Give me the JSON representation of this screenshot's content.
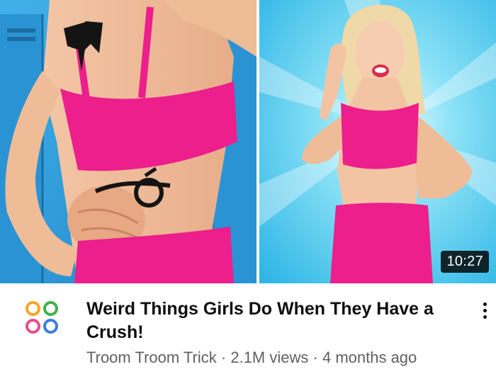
{
  "video": {
    "duration": "10:27",
    "title": "Weird Things Girls Do When They Have a Crush!",
    "channel": "Troom Troom Trick",
    "separator": "·",
    "views": "2.1M views",
    "age": "4 months ago"
  },
  "icons": {
    "channel_logo": "four-petal-flower-logo-icon",
    "more": "vertical-ellipsis-icon"
  },
  "colors": {
    "pink_top": "#ec1f8c",
    "left_background": "#2f9fd8",
    "right_background": "#5ad3f2",
    "title_text": "#0f0f0f",
    "meta_text": "#606060",
    "logo_orange": "#f5a623",
    "logo_pink": "#ea4c89",
    "logo_blue": "#3b7ddd",
    "logo_green": "#3bb34a"
  }
}
